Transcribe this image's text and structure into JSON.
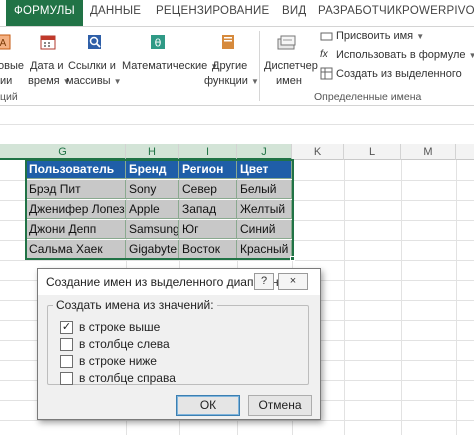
{
  "tabs": [
    {
      "label": "ФОРМУЛЫ",
      "active": true
    },
    {
      "label": "ДАННЫЕ"
    },
    {
      "label": "РЕЦЕНЗИРОВАНИЕ"
    },
    {
      "label": "ВИД"
    },
    {
      "label": "РАЗРАБОТЧИК"
    },
    {
      "label": "POWERPIVOT"
    }
  ],
  "ribbon": {
    "partial_left_1": "овые",
    "partial_left_2": "ии",
    "partial_group_left": "ций",
    "btn_datetime_1": "Дата и",
    "btn_datetime_2": "время",
    "btn_links_1": "Ссылки и",
    "btn_links_2": "массивы",
    "btn_math": "Математические",
    "btn_other_1": "Другие",
    "btn_other_2": "функции",
    "btn_manager_1": "Диспетчер",
    "btn_manager_2": "имен",
    "assign_name": "Присвоить имя",
    "use_in_formula": "Использовать в формуле",
    "create_from_selection": "Создать из выделенного",
    "group_defined_names": "Определенные имена"
  },
  "columns": [
    "G",
    "H",
    "I",
    "J",
    "K",
    "L",
    "M"
  ],
  "table": {
    "headers": [
      "Пользователь",
      "Бренд",
      "Регион",
      "Цвет"
    ],
    "rows": [
      [
        "Брэд Пит",
        "Sony",
        "Север",
        "Белый"
      ],
      [
        "Дженифер Лопез",
        "Apple",
        "Запад",
        "Желтый"
      ],
      [
        "Джони Депп",
        "Samsung",
        "Юг",
        "Синий"
      ],
      [
        "Сальма Хаек",
        "Gigabyte",
        "Восток",
        "Красный"
      ]
    ]
  },
  "dialog": {
    "title": "Создание имен из выделенного диапазона",
    "help": "?",
    "close": "×",
    "group_label": "Создать имена из значений:",
    "options": [
      {
        "label": "в строке выше",
        "checked": true
      },
      {
        "label": "в столбце слева",
        "checked": false
      },
      {
        "label": "в строке ниже",
        "checked": false
      },
      {
        "label": "в столбце справа",
        "checked": false
      }
    ],
    "ok": "ОК",
    "cancel": "Отмена",
    "check_mark": "✓"
  },
  "colors": {
    "accent": "#217346",
    "table_header_bg": "#1f5ea8",
    "table_body_bg": "#c8c8c8"
  }
}
